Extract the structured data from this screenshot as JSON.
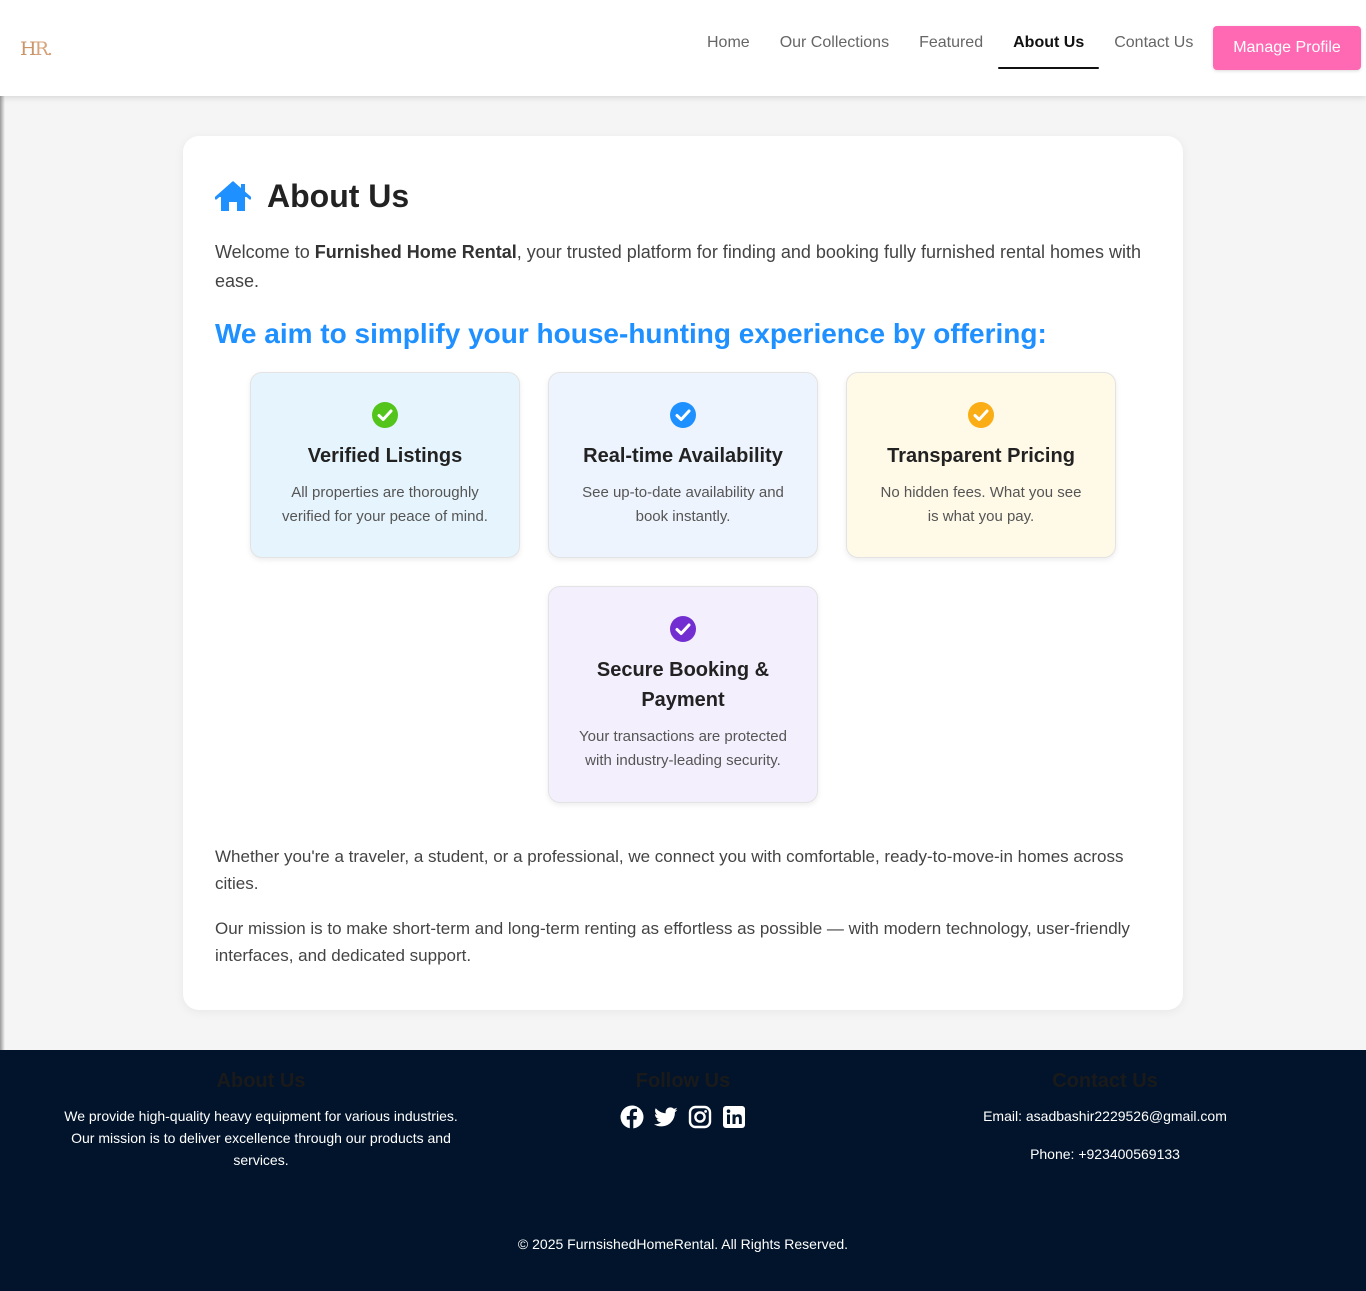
{
  "header": {
    "logo_h": "H",
    "logo_r": "R.",
    "nav": [
      {
        "label": "Home"
      },
      {
        "label": "Our Collections"
      },
      {
        "label": "Featured"
      },
      {
        "label": "About Us"
      },
      {
        "label": "Contact Us"
      }
    ],
    "active_nav": "About Us",
    "manage_profile_label": "Manage Profile"
  },
  "main": {
    "title": "About Us",
    "intro_prefix": "Welcome to ",
    "intro_brand": "Furnished Home Rental",
    "intro_suffix": ", your trusted platform for finding and booking fully furnished rental homes with ease.",
    "subtitle": "We aim to simplify your house-hunting experience by offering:",
    "features": [
      {
        "title": "Verified Listings",
        "text": "All properties are thoroughly verified for your peace of mind.",
        "icon": "check-circle-icon",
        "color": "#52c41a"
      },
      {
        "title": "Real-time Availability",
        "text": "See up-to-date availability and book instantly.",
        "icon": "check-circle-icon",
        "color": "#1e90ff"
      },
      {
        "title": "Transparent Pricing",
        "text": "No hidden fees. What you see is what you pay.",
        "icon": "check-circle-icon",
        "color": "#faad14"
      },
      {
        "title": "Secure Booking & Payment",
        "text": "Your transactions are protected with industry-leading security.",
        "icon": "check-circle-icon",
        "color": "#722ed1"
      }
    ],
    "paragraph_1": "Whether you're a traveler, a student, or a professional, we connect you with comfortable, ready-to-move-in homes across cities.",
    "paragraph_2": "Our mission is to make short-term and long-term renting as effortless as possible — with modern technology, user-friendly interfaces, and dedicated support."
  },
  "footer": {
    "about_heading": "About Us",
    "about_text": "We provide high-quality heavy equipment for various industries. Our mission is to deliver excellence through our products and services.",
    "follow_heading": "Follow Us",
    "socials": [
      "facebook-icon",
      "twitter-icon",
      "instagram-icon",
      "linkedin-icon"
    ],
    "contact_heading": "Contact Us",
    "email": "Email: asadbashir2229526@gmail.com",
    "phone": "Phone: +923400569133",
    "copyright": "© 2025 FurnsishedHomeRental. All Rights Reserved."
  },
  "colors": {
    "accent": "#1e90ff",
    "manage_button": "#ff69b4",
    "footer_bg": "#02142b"
  }
}
